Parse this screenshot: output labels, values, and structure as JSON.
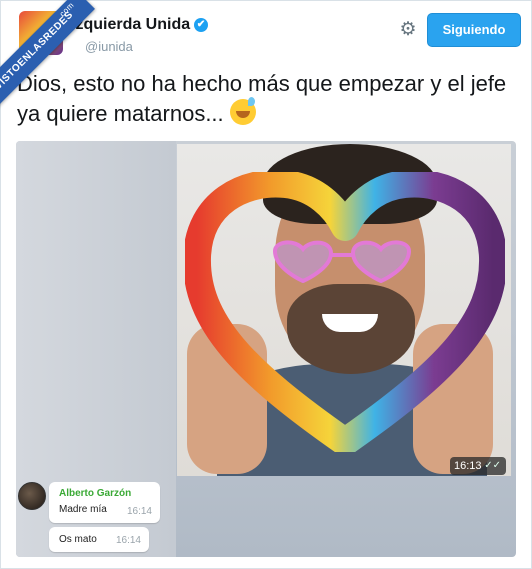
{
  "ribbon": {
    "label": "VISTOENLASREDES",
    "suffix": ".com"
  },
  "header": {
    "name": "Izquierda Unida",
    "verified_icon": "✔",
    "handle": "@iunida",
    "settings_icon": "gear-icon",
    "follow_label": "Siguiendo"
  },
  "tweet": {
    "text": "Dios, esto no ha hecho más que empezar y el jefe ya quiere matarnos... "
  },
  "media": {
    "photo_time": "16:13",
    "photo_ticks": "✓✓",
    "messages": [
      {
        "sender": "Alberto Garzón",
        "text": "Madre mía",
        "time": "16:14"
      },
      {
        "text": "Os mato",
        "time": "16:14"
      }
    ]
  },
  "colors": {
    "follow_button": "#2aa3ef",
    "verified": "#1da1f2",
    "sender_name": "#3aa935"
  }
}
